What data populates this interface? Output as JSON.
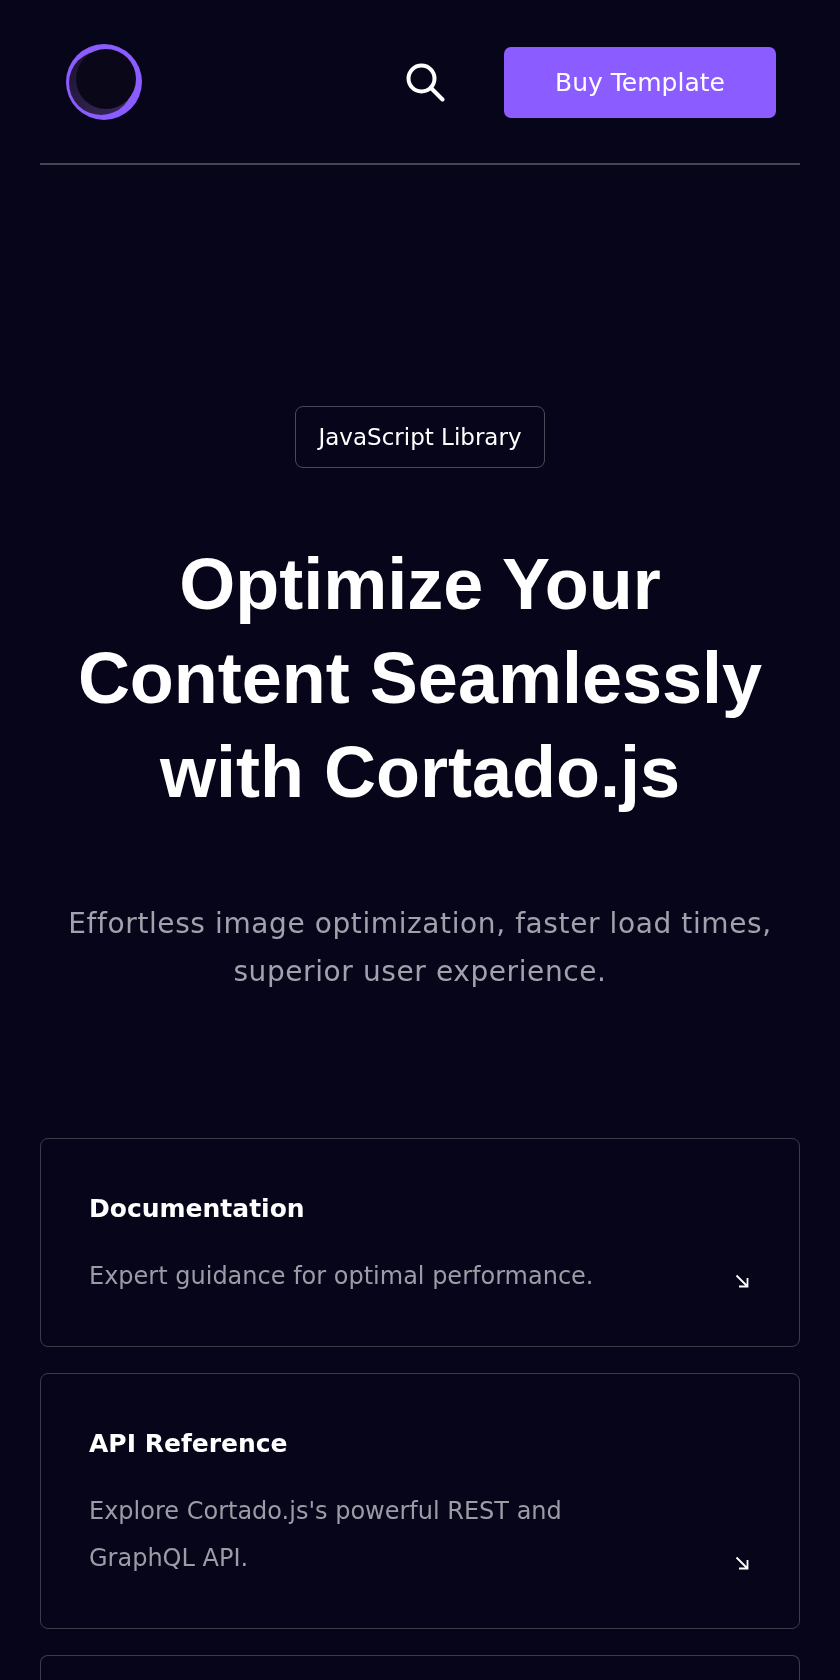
{
  "header": {
    "button": "Buy Template"
  },
  "hero": {
    "badge": "JavaScript Library",
    "title": "Optimize Your Content Seamlessly with Cortado.js",
    "subtitle": "Effortless image optimization, faster load times, superior user experience."
  },
  "cards": [
    {
      "title": "Documentation",
      "description": "Expert guidance for optimal performance."
    },
    {
      "title": "API Reference",
      "description": "Explore Cortado.js's powerful REST and GraphQL API."
    }
  ]
}
